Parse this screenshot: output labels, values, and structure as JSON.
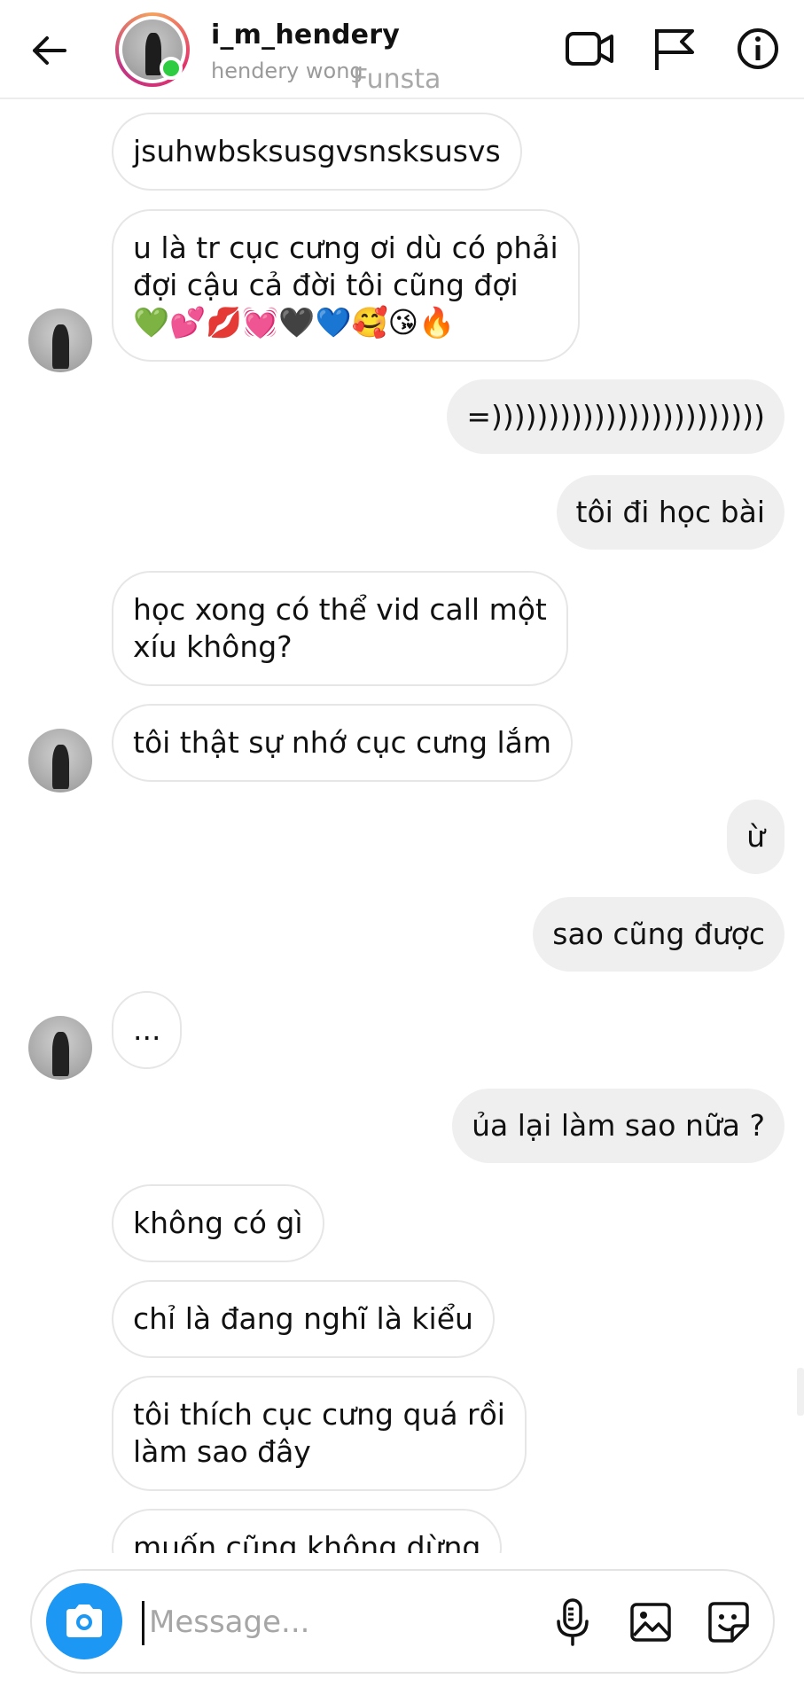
{
  "header": {
    "username": "i_m_hendery",
    "display_name": "hendery wong",
    "watermark": "Funsta",
    "online": true,
    "icons": [
      "back-arrow-icon",
      "video-call-icon",
      "flag-icon",
      "info-icon"
    ]
  },
  "messages": [
    {
      "side": "in",
      "text": "jsuhwbsksusgvsnsksusvs"
    },
    {
      "side": "in",
      "text": "u là tr cục cưng ơi dù có phải\nđợi cậu cả đời tôi cũng đợi\n💚💕💋💓🖤💙🥰😘🔥"
    },
    {
      "side": "out",
      "text": "=))))))))))))))))))))))))"
    },
    {
      "side": "out",
      "text": "tôi đi học bài"
    },
    {
      "side": "in",
      "text": "học xong có thể vid call một\nxíu không?"
    },
    {
      "side": "in",
      "text": "tôi thật sự nhớ cục cưng lắm"
    },
    {
      "side": "out",
      "text": "ừ"
    },
    {
      "side": "out",
      "text": "sao cũng được"
    },
    {
      "side": "in",
      "text": "..."
    },
    {
      "side": "out",
      "text": "ủa lại làm sao nữa ?"
    },
    {
      "side": "in",
      "text": "không có gì"
    },
    {
      "side": "in",
      "text": "chỉ là đang nghĩ là kiểu"
    },
    {
      "side": "in",
      "text": "tôi thích cục cưng quá rồi\nlàm sao đây"
    },
    {
      "side": "in",
      "text": "muốn cũng không dừng"
    }
  ],
  "composer": {
    "placeholder": "Message...",
    "icons": [
      "camera-icon",
      "microphone-icon",
      "gallery-icon",
      "sticker-icon"
    ]
  },
  "colors": {
    "send_button": "#1c97f3",
    "online_dot": "#2ecc40",
    "outgoing_bubble": "#efefef"
  }
}
